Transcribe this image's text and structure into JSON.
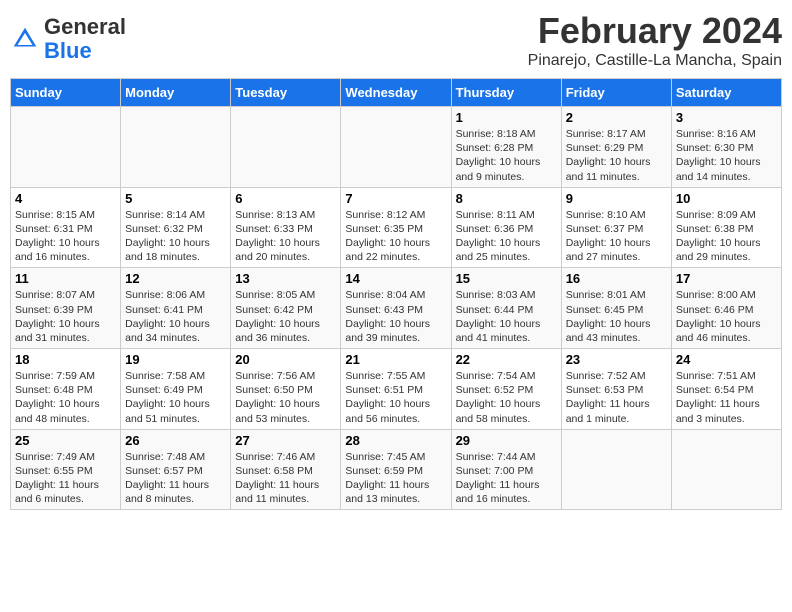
{
  "header": {
    "logo_general": "General",
    "logo_blue": "Blue",
    "month_title": "February 2024",
    "location": "Pinarejo, Castille-La Mancha, Spain"
  },
  "days_of_week": [
    "Sunday",
    "Monday",
    "Tuesday",
    "Wednesday",
    "Thursday",
    "Friday",
    "Saturday"
  ],
  "weeks": [
    [
      {
        "day": "",
        "info": ""
      },
      {
        "day": "",
        "info": ""
      },
      {
        "day": "",
        "info": ""
      },
      {
        "day": "",
        "info": ""
      },
      {
        "day": "1",
        "info": "Sunrise: 8:18 AM\nSunset: 6:28 PM\nDaylight: 10 hours\nand 9 minutes."
      },
      {
        "day": "2",
        "info": "Sunrise: 8:17 AM\nSunset: 6:29 PM\nDaylight: 10 hours\nand 11 minutes."
      },
      {
        "day": "3",
        "info": "Sunrise: 8:16 AM\nSunset: 6:30 PM\nDaylight: 10 hours\nand 14 minutes."
      }
    ],
    [
      {
        "day": "4",
        "info": "Sunrise: 8:15 AM\nSunset: 6:31 PM\nDaylight: 10 hours\nand 16 minutes."
      },
      {
        "day": "5",
        "info": "Sunrise: 8:14 AM\nSunset: 6:32 PM\nDaylight: 10 hours\nand 18 minutes."
      },
      {
        "day": "6",
        "info": "Sunrise: 8:13 AM\nSunset: 6:33 PM\nDaylight: 10 hours\nand 20 minutes."
      },
      {
        "day": "7",
        "info": "Sunrise: 8:12 AM\nSunset: 6:35 PM\nDaylight: 10 hours\nand 22 minutes."
      },
      {
        "day": "8",
        "info": "Sunrise: 8:11 AM\nSunset: 6:36 PM\nDaylight: 10 hours\nand 25 minutes."
      },
      {
        "day": "9",
        "info": "Sunrise: 8:10 AM\nSunset: 6:37 PM\nDaylight: 10 hours\nand 27 minutes."
      },
      {
        "day": "10",
        "info": "Sunrise: 8:09 AM\nSunset: 6:38 PM\nDaylight: 10 hours\nand 29 minutes."
      }
    ],
    [
      {
        "day": "11",
        "info": "Sunrise: 8:07 AM\nSunset: 6:39 PM\nDaylight: 10 hours\nand 31 minutes."
      },
      {
        "day": "12",
        "info": "Sunrise: 8:06 AM\nSunset: 6:41 PM\nDaylight: 10 hours\nand 34 minutes."
      },
      {
        "day": "13",
        "info": "Sunrise: 8:05 AM\nSunset: 6:42 PM\nDaylight: 10 hours\nand 36 minutes."
      },
      {
        "day": "14",
        "info": "Sunrise: 8:04 AM\nSunset: 6:43 PM\nDaylight: 10 hours\nand 39 minutes."
      },
      {
        "day": "15",
        "info": "Sunrise: 8:03 AM\nSunset: 6:44 PM\nDaylight: 10 hours\nand 41 minutes."
      },
      {
        "day": "16",
        "info": "Sunrise: 8:01 AM\nSunset: 6:45 PM\nDaylight: 10 hours\nand 43 minutes."
      },
      {
        "day": "17",
        "info": "Sunrise: 8:00 AM\nSunset: 6:46 PM\nDaylight: 10 hours\nand 46 minutes."
      }
    ],
    [
      {
        "day": "18",
        "info": "Sunrise: 7:59 AM\nSunset: 6:48 PM\nDaylight: 10 hours\nand 48 minutes."
      },
      {
        "day": "19",
        "info": "Sunrise: 7:58 AM\nSunset: 6:49 PM\nDaylight: 10 hours\nand 51 minutes."
      },
      {
        "day": "20",
        "info": "Sunrise: 7:56 AM\nSunset: 6:50 PM\nDaylight: 10 hours\nand 53 minutes."
      },
      {
        "day": "21",
        "info": "Sunrise: 7:55 AM\nSunset: 6:51 PM\nDaylight: 10 hours\nand 56 minutes."
      },
      {
        "day": "22",
        "info": "Sunrise: 7:54 AM\nSunset: 6:52 PM\nDaylight: 10 hours\nand 58 minutes."
      },
      {
        "day": "23",
        "info": "Sunrise: 7:52 AM\nSunset: 6:53 PM\nDaylight: 11 hours\nand 1 minute."
      },
      {
        "day": "24",
        "info": "Sunrise: 7:51 AM\nSunset: 6:54 PM\nDaylight: 11 hours\nand 3 minutes."
      }
    ],
    [
      {
        "day": "25",
        "info": "Sunrise: 7:49 AM\nSunset: 6:55 PM\nDaylight: 11 hours\nand 6 minutes."
      },
      {
        "day": "26",
        "info": "Sunrise: 7:48 AM\nSunset: 6:57 PM\nDaylight: 11 hours\nand 8 minutes."
      },
      {
        "day": "27",
        "info": "Sunrise: 7:46 AM\nSunset: 6:58 PM\nDaylight: 11 hours\nand 11 minutes."
      },
      {
        "day": "28",
        "info": "Sunrise: 7:45 AM\nSunset: 6:59 PM\nDaylight: 11 hours\nand 13 minutes."
      },
      {
        "day": "29",
        "info": "Sunrise: 7:44 AM\nSunset: 7:00 PM\nDaylight: 11 hours\nand 16 minutes."
      },
      {
        "day": "",
        "info": ""
      },
      {
        "day": "",
        "info": ""
      }
    ]
  ]
}
